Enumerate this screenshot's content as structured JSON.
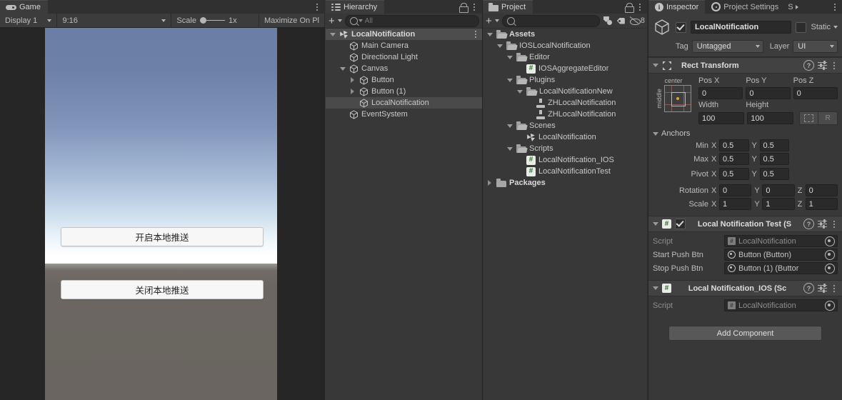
{
  "game": {
    "tab_label": "Game",
    "tab_icon": "gamepad-icon",
    "display_label": "Display 1",
    "aspect_label": "9:16",
    "scale_label": "Scale",
    "scale_value": "1x",
    "maximize_label": "Maximize On Pl",
    "buttons": [
      {
        "text": "开启本地推送"
      },
      {
        "text": "关闭本地推送"
      }
    ]
  },
  "hierarchy": {
    "tab_label": "Hierarchy",
    "search_placeholder": "All",
    "items": [
      {
        "label": "LocalNotification",
        "icon": "scene-icon",
        "indent": 0,
        "arrow": "down",
        "selected": true,
        "bold": true,
        "kebab": true
      },
      {
        "label": "Main Camera",
        "icon": "gameobject-icon",
        "indent": 1,
        "arrow": "none",
        "selected": false,
        "bold": false,
        "kebab": false
      },
      {
        "label": "Directional Light",
        "icon": "gameobject-icon",
        "indent": 1,
        "arrow": "none",
        "selected": false,
        "bold": false,
        "kebab": false
      },
      {
        "label": "Canvas",
        "icon": "gameobject-icon",
        "indent": 1,
        "arrow": "down",
        "selected": false,
        "bold": false,
        "kebab": false
      },
      {
        "label": "Button",
        "icon": "gameobject-icon",
        "indent": 2,
        "arrow": "right",
        "selected": false,
        "bold": false,
        "kebab": false
      },
      {
        "label": "Button (1)",
        "icon": "gameobject-icon",
        "indent": 2,
        "arrow": "right",
        "selected": false,
        "bold": false,
        "kebab": false
      },
      {
        "label": "LocalNotification",
        "icon": "gameobject-icon",
        "indent": 2,
        "arrow": "none",
        "selected": true,
        "bold": false,
        "kebab": false
      },
      {
        "label": "EventSystem",
        "icon": "gameobject-icon",
        "indent": 1,
        "arrow": "none",
        "selected": false,
        "bold": false,
        "kebab": false
      }
    ]
  },
  "project": {
    "tab_label": "Project",
    "search_placeholder": "",
    "hidden_count": "8",
    "items": [
      {
        "label": "Assets",
        "icon": "folder-icon",
        "indent": 0,
        "arrow": "down",
        "bold": true
      },
      {
        "label": "IOSLocalNotification",
        "icon": "folder-icon",
        "indent": 1,
        "arrow": "down",
        "bold": false
      },
      {
        "label": "Editor",
        "icon": "folder-icon",
        "indent": 2,
        "arrow": "down",
        "bold": false
      },
      {
        "label": "IOSAggregateEditor",
        "icon": "cs-script-icon",
        "indent": 3,
        "arrow": "none",
        "bold": false
      },
      {
        "label": "Plugins",
        "icon": "folder-icon",
        "indent": 2,
        "arrow": "down",
        "bold": false
      },
      {
        "label": "LocalNotificationNew",
        "icon": "folder-icon",
        "indent": 3,
        "arrow": "down",
        "bold": false
      },
      {
        "label": "ZHLocalNotification",
        "icon": "plugin-icon",
        "indent": 4,
        "arrow": "none",
        "bold": false
      },
      {
        "label": "ZHLocalNotification",
        "icon": "plugin-icon",
        "indent": 4,
        "arrow": "none",
        "bold": false
      },
      {
        "label": "Scenes",
        "icon": "folder-icon",
        "indent": 2,
        "arrow": "down",
        "bold": false
      },
      {
        "label": "LocalNotification",
        "icon": "scene-icon",
        "indent": 3,
        "arrow": "none",
        "bold": false
      },
      {
        "label": "Scripts",
        "icon": "folder-icon",
        "indent": 2,
        "arrow": "down",
        "bold": false
      },
      {
        "label": "LocalNotification_IOS",
        "icon": "cs-script-icon",
        "indent": 3,
        "arrow": "none",
        "bold": false
      },
      {
        "label": "LocalNotificationTest",
        "icon": "cs-script-icon",
        "indent": 3,
        "arrow": "none",
        "bold": false
      },
      {
        "label": "Packages",
        "icon": "folder-icon",
        "indent": 0,
        "arrow": "right",
        "bold": true
      }
    ]
  },
  "inspector": {
    "tabs": [
      {
        "label": "Inspector",
        "icon": "info-icon",
        "active": true
      },
      {
        "label": "Project Settings",
        "icon": "gear-icon",
        "active": false
      },
      {
        "label": "S",
        "icon": "none",
        "active": false
      }
    ],
    "object": {
      "name": "LocalNotification",
      "enabled": true,
      "static_label": "Static",
      "static_checked": false,
      "tag_label": "Tag",
      "tag_value": "Untagged",
      "layer_label": "Layer",
      "layer_value": "UI"
    },
    "rect_transform": {
      "title": "Rect Transform",
      "anchor_preset_h": "center",
      "anchor_preset_v": "middle",
      "pos_x_label": "Pos X",
      "pos_x": "0",
      "pos_y_label": "Pos Y",
      "pos_y": "0",
      "pos_z_label": "Pos Z",
      "pos_z": "0",
      "width_label": "Width",
      "width": "100",
      "height_label": "Height",
      "height": "100",
      "blueprint_label": "",
      "raw_label": "R",
      "anchors_label": "Anchors",
      "min_label": "Min",
      "min_x": "0.5",
      "min_y": "0.5",
      "max_label": "Max",
      "max_x": "0.5",
      "max_y": "0.5",
      "pivot_label": "Pivot",
      "pivot_x": "0.5",
      "pivot_y": "0.5",
      "rotation_label": "Rotation",
      "rot_x": "0",
      "rot_y": "0",
      "rot_z": "0",
      "scale_label": "Scale",
      "scale_x": "1",
      "scale_y": "1",
      "scale_z": "1",
      "axis_x": "X",
      "axis_y": "Y",
      "axis_z": "Z"
    },
    "components": [
      {
        "title": "Local Notification Test (S",
        "has_enable_checkbox": true,
        "enabled": true,
        "fields": [
          {
            "label": "Script",
            "value": "LocalNotification",
            "icon": "script-icon",
            "dim": true,
            "target": true
          },
          {
            "label": "Start Push Btn",
            "value": "Button (Button)",
            "icon": "radio-icon",
            "dim": false,
            "target": true
          },
          {
            "label": "Stop Push Btn",
            "value": "Button (1) (Buttor",
            "icon": "radio-icon",
            "dim": false,
            "target": true
          }
        ]
      },
      {
        "title": "Local Notification_IOS (Sc",
        "has_enable_checkbox": false,
        "enabled": false,
        "fields": [
          {
            "label": "Script",
            "value": "LocalNotification",
            "icon": "script-icon",
            "dim": true,
            "target": true
          }
        ]
      }
    ],
    "add_component_label": "Add Component"
  },
  "colors": {
    "panel_bg": "#383838",
    "panel_header": "#303030",
    "selection": "#4a4a4a",
    "field_bg": "#2a2a2a",
    "text": "#c4c4c4",
    "sky_top": "#6a7ea6",
    "ground": "#6a6560"
  }
}
